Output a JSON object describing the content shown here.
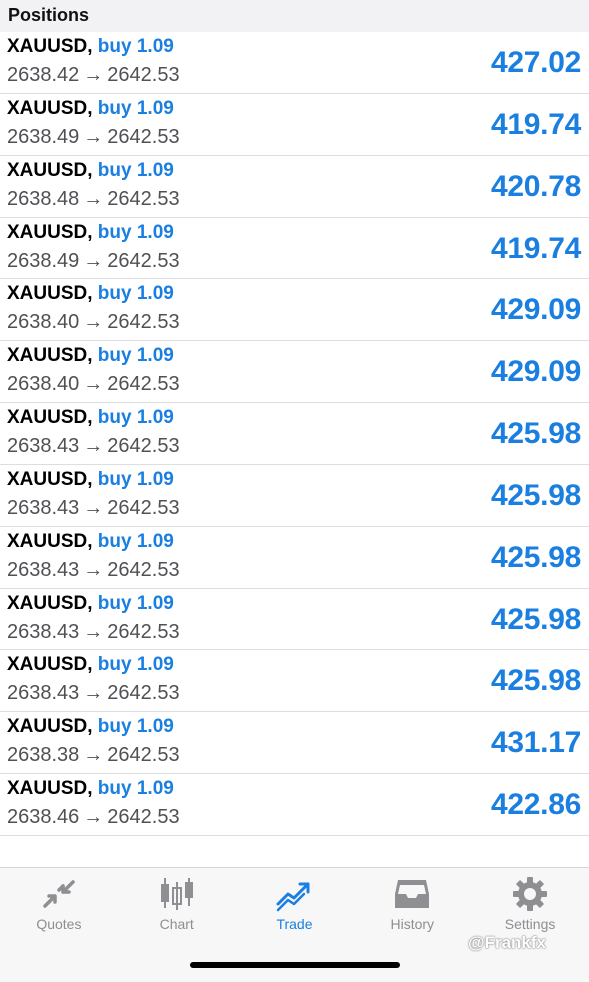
{
  "header": {
    "title": "Positions"
  },
  "positions": [
    {
      "symbol": "XAUUSD",
      "side": "buy 1.09",
      "open": "2638.42",
      "arrow": "→",
      "current": "2642.53",
      "profit": "427.02"
    },
    {
      "symbol": "XAUUSD",
      "side": "buy 1.09",
      "open": "2638.49",
      "arrow": "→",
      "current": "2642.53",
      "profit": "419.74"
    },
    {
      "symbol": "XAUUSD",
      "side": "buy 1.09",
      "open": "2638.48",
      "arrow": "→",
      "current": "2642.53",
      "profit": "420.78"
    },
    {
      "symbol": "XAUUSD",
      "side": "buy 1.09",
      "open": "2638.49",
      "arrow": "→",
      "current": "2642.53",
      "profit": "419.74"
    },
    {
      "symbol": "XAUUSD",
      "side": "buy 1.09",
      "open": "2638.40",
      "arrow": "→",
      "current": "2642.53",
      "profit": "429.09"
    },
    {
      "symbol": "XAUUSD",
      "side": "buy 1.09",
      "open": "2638.40",
      "arrow": "→",
      "current": "2642.53",
      "profit": "429.09"
    },
    {
      "symbol": "XAUUSD",
      "side": "buy 1.09",
      "open": "2638.43",
      "arrow": "→",
      "current": "2642.53",
      "profit": "425.98"
    },
    {
      "symbol": "XAUUSD",
      "side": "buy 1.09",
      "open": "2638.43",
      "arrow": "→",
      "current": "2642.53",
      "profit": "425.98"
    },
    {
      "symbol": "XAUUSD",
      "side": "buy 1.09",
      "open": "2638.43",
      "arrow": "→",
      "current": "2642.53",
      "profit": "425.98"
    },
    {
      "symbol": "XAUUSD",
      "side": "buy 1.09",
      "open": "2638.43",
      "arrow": "→",
      "current": "2642.53",
      "profit": "425.98"
    },
    {
      "symbol": "XAUUSD",
      "side": "buy 1.09",
      "open": "2638.43",
      "arrow": "→",
      "current": "2642.53",
      "profit": "425.98"
    },
    {
      "symbol": "XAUUSD",
      "side": "buy 1.09",
      "open": "2638.38",
      "arrow": "→",
      "current": "2642.53",
      "profit": "431.17"
    },
    {
      "symbol": "XAUUSD",
      "side": "buy 1.09",
      "open": "2638.46",
      "arrow": "→",
      "current": "2642.53",
      "profit": "422.86"
    }
  ],
  "tabbar": {
    "tabs": [
      {
        "label": "Quotes",
        "icon": "quotes-icon"
      },
      {
        "label": "Chart",
        "icon": "chart-icon"
      },
      {
        "label": "Trade",
        "icon": "trade-icon",
        "active": true
      },
      {
        "label": "History",
        "icon": "history-icon"
      },
      {
        "label": "Settings",
        "icon": "settings-icon"
      }
    ]
  },
  "watermark": "@Frankfx",
  "colors": {
    "accent": "#1a7fe0",
    "inactive": "#8e8e93",
    "header_bg": "#f2f2f4"
  }
}
